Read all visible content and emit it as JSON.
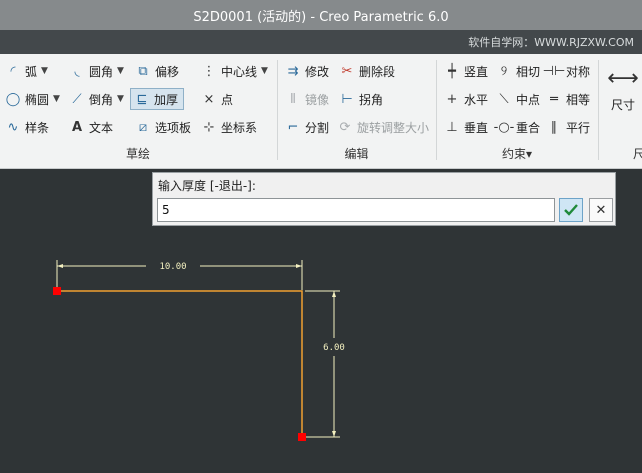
{
  "window": {
    "title": "S2D0001 (活动的) - Creo Parametric 6.0"
  },
  "watermark": "软件自学网：WWW.RJZXW.COM",
  "ribbon": {
    "sketch": {
      "label": "草绘",
      "arc": "弧",
      "fillet": "圆角",
      "offset": "偏移",
      "centerline": "中心线",
      "ellipse": "椭圆",
      "chamfer": "倒角",
      "thicken": "加厚",
      "point": "点",
      "spline": "样条",
      "text": "文本",
      "palette": "选项板",
      "csys": "坐标系"
    },
    "edit": {
      "label": "编辑",
      "modify": "修改",
      "delete_segment": "删除段",
      "mirror": "镜像",
      "corner": "拐角",
      "divide": "分割",
      "rotate_resize": "旋转调整大小"
    },
    "constrain": {
      "label": "约束▾",
      "vertical": "竖直",
      "tangent": "相切",
      "symmetric": "对称",
      "horizontal": "水平",
      "midpoint": "中点",
      "equal": "相等",
      "perpendicular": "垂直",
      "coincident": "重合",
      "parallel": "平行"
    },
    "dimension": {
      "dim_button": "尺寸",
      "label_partial": "尺"
    }
  },
  "dialog": {
    "prompt": "输入厚度 [-退出-]:",
    "value": "5"
  },
  "sketch": {
    "dim_horizontal": "10.00",
    "dim_vertical": "6.00",
    "colors": {
      "line": "#f0a030",
      "dimension": "#f3f0c0",
      "vertex": "#ff0000"
    }
  }
}
